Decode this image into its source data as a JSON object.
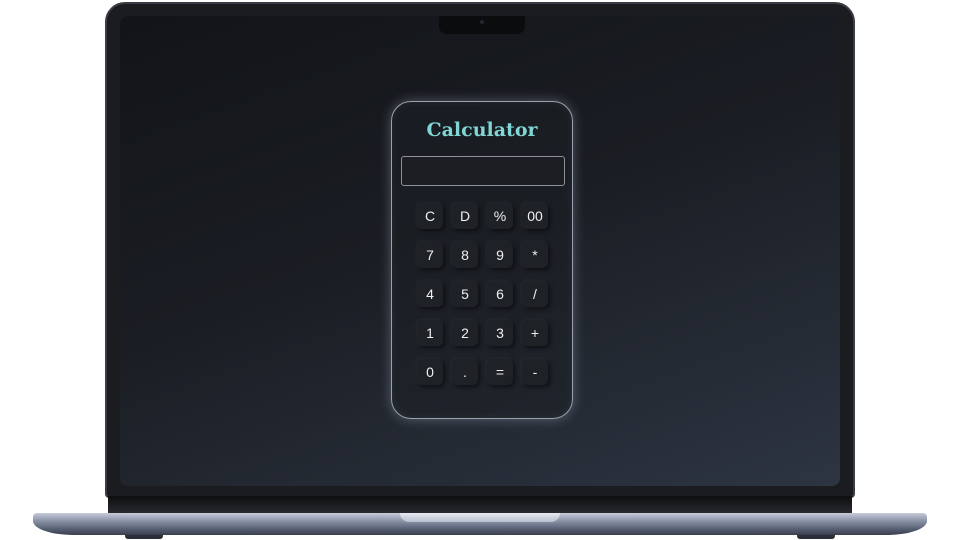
{
  "calculator": {
    "title": "Calculator",
    "display_value": "",
    "keys": [
      [
        "C",
        "D",
        "%",
        "00"
      ],
      [
        "7",
        "8",
        "9",
        "*"
      ],
      [
        "4",
        "5",
        "6",
        "/"
      ],
      [
        "1",
        "2",
        "3",
        "+"
      ],
      [
        "0",
        ".",
        "=",
        "-"
      ]
    ]
  },
  "colors": {
    "title_accent": "#7fd6d4",
    "screen_background_dark": "#121418",
    "screen_background_light": "#2d3542",
    "key_background": "#1e2126",
    "key_text": "#eef0f3"
  }
}
